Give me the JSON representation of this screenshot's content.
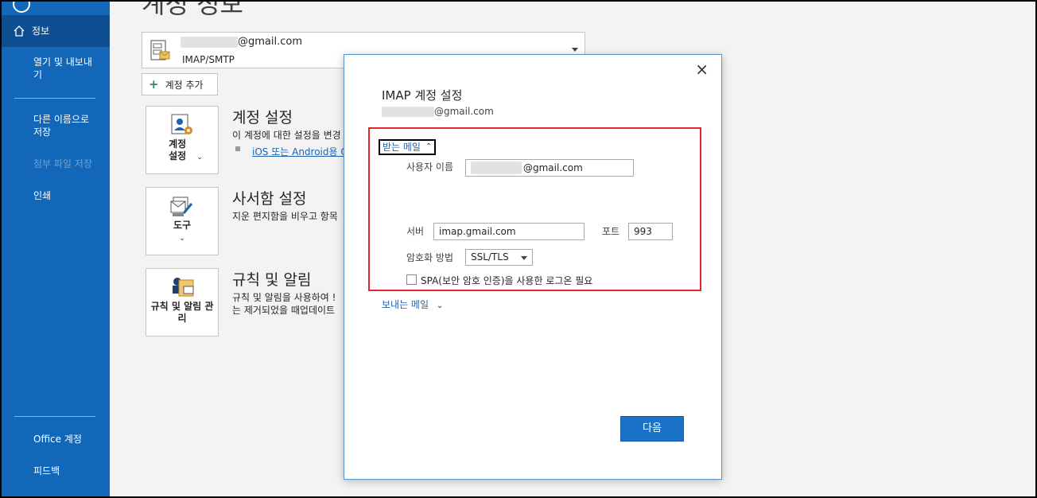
{
  "sidebar": {
    "items": [
      {
        "label": "정보"
      },
      {
        "label": "열기 및 내보내기"
      },
      {
        "label": "다른 이름으로 저장"
      },
      {
        "label": "첨부 파일 저장"
      },
      {
        "label": "인쇄"
      }
    ],
    "bottom_items": [
      {
        "label": "Office 계정"
      },
      {
        "label": "피드백"
      }
    ]
  },
  "main": {
    "page_title": "계정 정보",
    "account": {
      "email_suffix": "@gmail.com",
      "type": "IMAP/SMTP"
    },
    "add_account_label": "계정 추가",
    "sections": [
      {
        "tile_label": "계정 설정",
        "title": "계정 설정",
        "desc": "이 계정에 대한 설정을 변경",
        "link": "iOS 또는 Android용 O"
      },
      {
        "tile_label": "도구",
        "title": "사서함 설정",
        "desc": "지운 편지함을 비우고 항목"
      },
      {
        "tile_label": "규칙 및 알림 관리",
        "title": "규칙 및 알림",
        "desc_line1": "규칙 및 알림을 사용하여 !",
        "desc_line2": "는 제거되었을 때업데이트"
      }
    ]
  },
  "dialog": {
    "close_icon": "×",
    "title": "IMAP 계정 설정",
    "subtitle_email_suffix": "@gmail.com",
    "incoming_label": "받는 메일",
    "username_label": "사용자 이름",
    "username_value_suffix": "@gmail.com",
    "server_label": "서버",
    "server_value": "imap.gmail.com",
    "port_label": "포트",
    "port_value": "993",
    "encryption_label": "암호화 방법",
    "encryption_value": "SSL/TLS",
    "spa_label": "SPA(보안 암호 인증)을 사용한 로그온 필요",
    "outgoing_label": "보내는 메일",
    "next_button": "다음"
  },
  "colors": {
    "sidebar": "#1367b9",
    "sidebar_active": "#0e4f91",
    "highlight_box": "#e0262e",
    "primary_button": "#1a73c6",
    "link": "#1e63b0"
  },
  "icons": {
    "home": "home-icon",
    "back": "back-arrow-icon",
    "account_settings": "account-settings-icon",
    "tools": "mailbox-tools-icon",
    "rules": "rules-alerts-icon",
    "add": "plus-icon",
    "chevron_up": "chevron-up-icon",
    "chevron_down": "chevron-down-icon"
  }
}
